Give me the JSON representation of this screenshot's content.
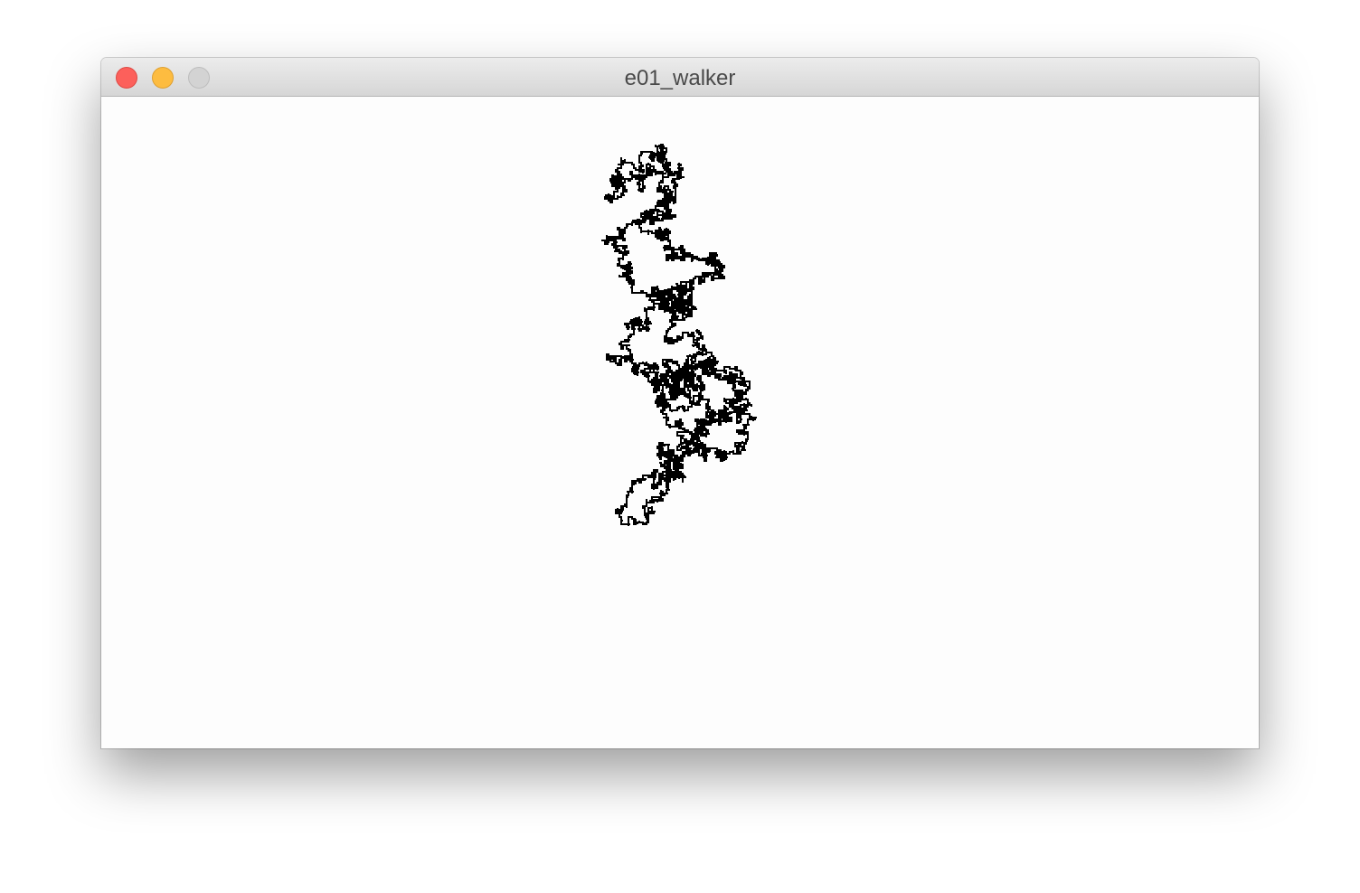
{
  "window": {
    "title": "e01_walker"
  },
  "controls": {
    "close_icon": "close-circle",
    "minimize_icon": "minimize-circle",
    "zoom_icon": "zoom-circle-disabled"
  },
  "colors": {
    "background": "#fdfdfd",
    "walker_stroke": "#000000",
    "close": "#fc605b",
    "minimize": "#fdbc40",
    "zoom_disabled": "#d3d3d3"
  }
}
